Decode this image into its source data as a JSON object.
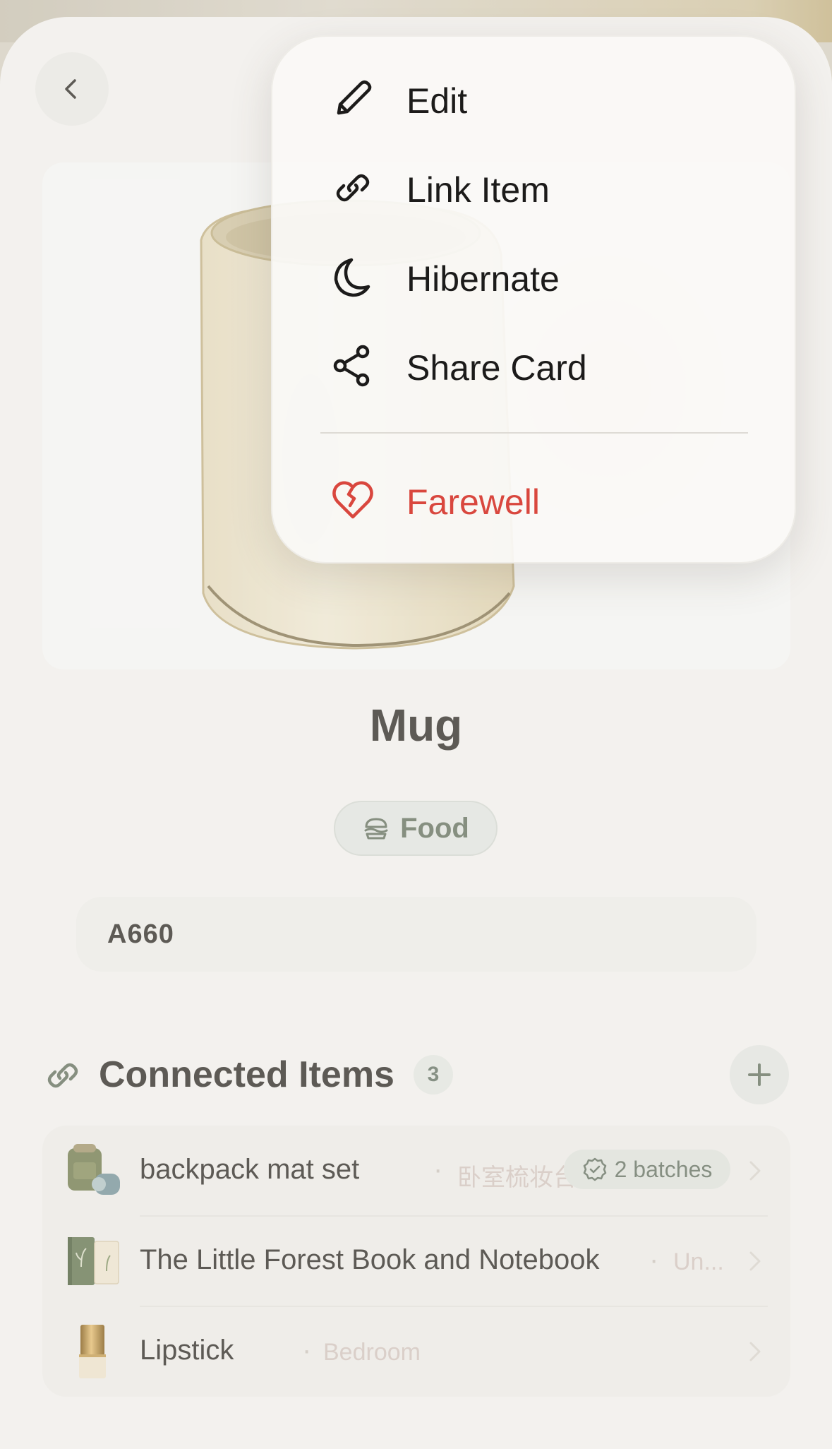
{
  "item": {
    "title": "Mug",
    "category": "Food",
    "code": "A660"
  },
  "connected": {
    "title": "Connected Items",
    "count": "3",
    "items": [
      {
        "name": "backpack mat set",
        "location": "卧室梳妆台",
        "badge": "2 batches"
      },
      {
        "name": "The Little Forest Book and Notebook",
        "location": "Un..."
      },
      {
        "name": "Lipstick",
        "location": "Bedroom"
      }
    ]
  },
  "menu": {
    "items": [
      {
        "label": "Edit",
        "icon": "pencil-icon"
      },
      {
        "label": "Link Item",
        "icon": "link-icon"
      },
      {
        "label": "Hibernate",
        "icon": "moon-icon"
      },
      {
        "label": "Share Card",
        "icon": "share-icon"
      }
    ],
    "danger": {
      "label": "Farewell",
      "icon": "broken-heart-icon",
      "color": "#d9473e"
    }
  },
  "colors": {
    "accent_green": "#6f7b6a",
    "background": "#f4f2ef",
    "danger": "#d9473e"
  }
}
